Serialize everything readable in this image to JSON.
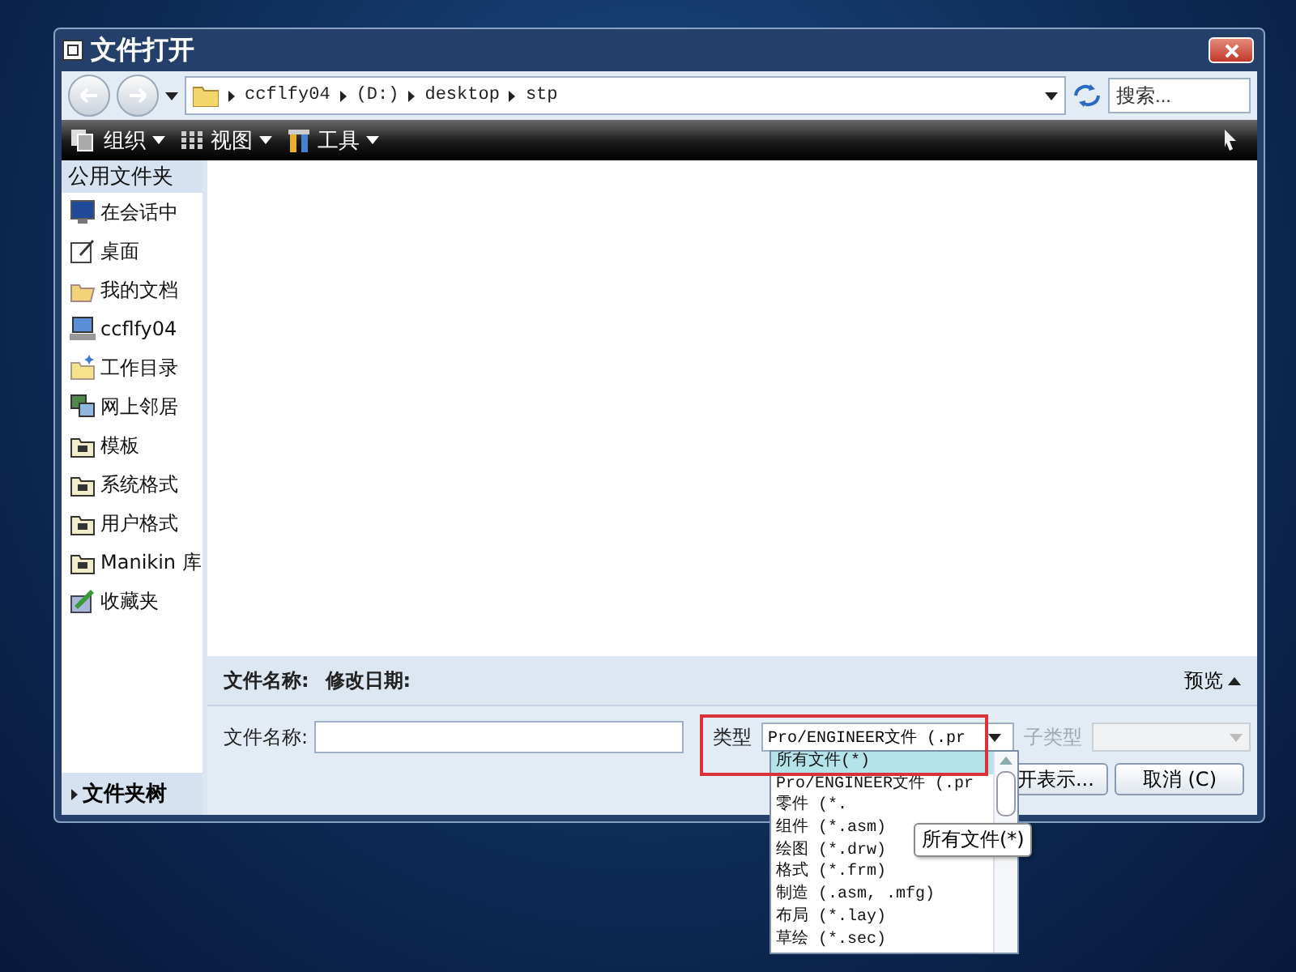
{
  "window": {
    "title": "文件打开"
  },
  "address": {
    "segments": [
      "ccflfy04",
      "(D:)",
      "desktop",
      "stp"
    ]
  },
  "search": {
    "placeholder": "搜索..."
  },
  "toolbar": [
    {
      "label": "组织",
      "kind": "organize"
    },
    {
      "label": "视图",
      "kind": "view"
    },
    {
      "label": "工具",
      "kind": "tools"
    }
  ],
  "sidebar": {
    "title": "公用文件夹",
    "items": [
      {
        "label": "在会话中",
        "kind": "session"
      },
      {
        "label": "桌面",
        "kind": "desktop"
      },
      {
        "label": "我的文档",
        "kind": "documents"
      },
      {
        "label": "ccflfy04",
        "kind": "computer"
      },
      {
        "label": "工作目录",
        "kind": "workdir"
      },
      {
        "label": "网上邻居",
        "kind": "network"
      },
      {
        "label": "模板",
        "kind": "folder"
      },
      {
        "label": "系统格式",
        "kind": "folder"
      },
      {
        "label": "用户格式",
        "kind": "folder"
      },
      {
        "label": "Manikin 库",
        "kind": "folder"
      },
      {
        "label": "收藏夹",
        "kind": "favorites"
      }
    ],
    "footer": "文件夹树"
  },
  "columns": [
    "文件名称:",
    "修改日期:"
  ],
  "preview": {
    "label": "预览"
  },
  "form": {
    "name_label": "文件名称:",
    "type_label": "类型",
    "type_value": "Pro/ENGINEER文件 (.pr",
    "subtype_label": "子类型",
    "subtype_disabled": true
  },
  "buttons": [
    {
      "label": "开表示..."
    },
    {
      "label": "取消 (C)"
    }
  ],
  "type_list": [
    {
      "label": "所有文件(*)",
      "selected": true
    },
    {
      "label": "Pro/ENGINEER文件 (.pr",
      "selected": false
    },
    {
      "label": "零件 (*.",
      "selected": false
    },
    {
      "label": "组件 (*.asm)",
      "selected": false
    },
    {
      "label": "绘图 (*.drw)",
      "selected": false
    },
    {
      "label": "格式 (*.frm)",
      "selected": false
    },
    {
      "label": "制造 (.asm, .mfg)",
      "selected": false
    },
    {
      "label": "布局 (*.lay)",
      "selected": false
    },
    {
      "label": "草绘 (*.sec)",
      "selected": false
    }
  ],
  "tooltip": "所有文件(*)"
}
